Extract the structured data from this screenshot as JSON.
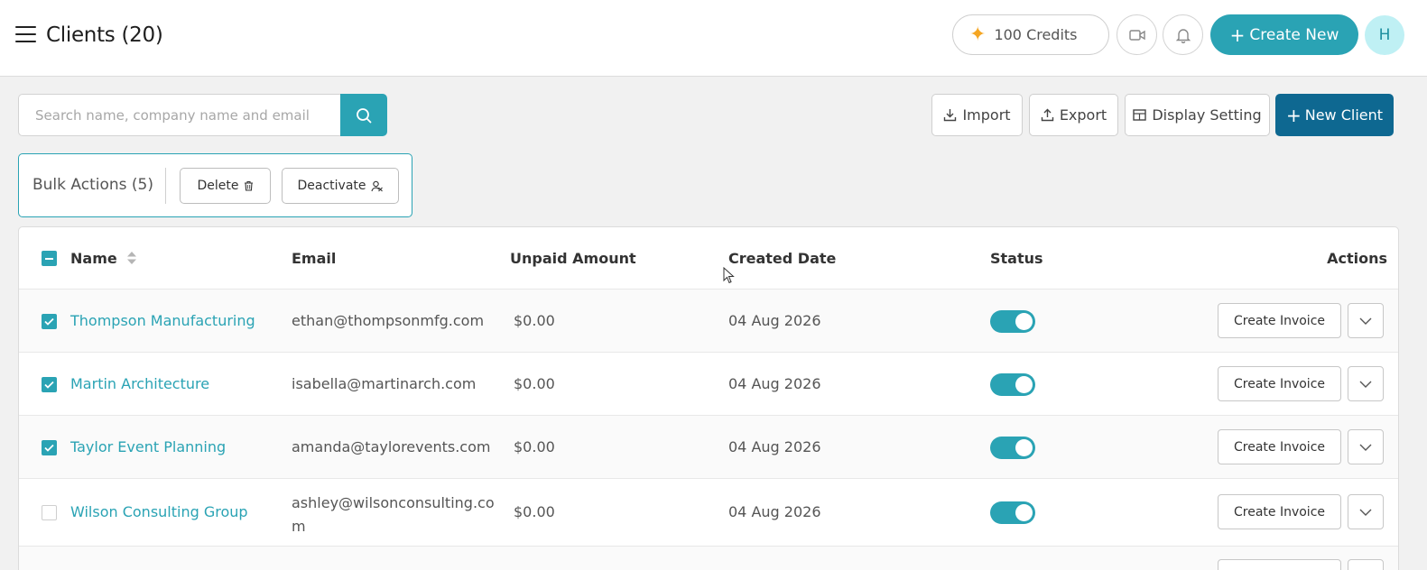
{
  "header": {
    "title": "Clients (20)",
    "credits_label": "100 Credits",
    "create_new_label": "Create New",
    "avatar_initial": "H"
  },
  "toolbar": {
    "search_placeholder": "Search name, company name and email",
    "import_label": "Import",
    "export_label": "Export",
    "display_setting_label": "Display Setting",
    "new_client_label": "New Client"
  },
  "bulk": {
    "label": "Bulk Actions (5)",
    "delete_label": "Delete",
    "deactivate_label": "Deactivate"
  },
  "table": {
    "columns": [
      "Name",
      "Email",
      "Unpaid Amount",
      "Created Date",
      "Status",
      "Actions"
    ],
    "rows": [
      {
        "checked": true,
        "name": "Thompson Manufacturing",
        "email": "ethan@thompsonmfg.com",
        "unpaid": "$0.00",
        "created": "04 Aug 2026",
        "active": true,
        "action_label": "Create Invoice"
      },
      {
        "checked": true,
        "name": "Martin Architecture",
        "email": "isabella@martinarch.com",
        "unpaid": "$0.00",
        "created": "04 Aug 2026",
        "active": true,
        "action_label": "Create Invoice"
      },
      {
        "checked": true,
        "name": "Taylor Event Planning",
        "email": "amanda@taylorevents.com",
        "unpaid": "$0.00",
        "created": "04 Aug 2026",
        "active": true,
        "action_label": "Create Invoice"
      },
      {
        "checked": false,
        "name": "Wilson Consulting Group",
        "email_line1": "ashley@wilsonconsulting.co",
        "email_line2": "m",
        "unpaid": "$0.00",
        "created": "04 Aug 2026",
        "active": true,
        "action_label": "Create Invoice"
      }
    ]
  },
  "colors": {
    "accent": "#2aa3b4",
    "primary_dark": "#0e6891",
    "credits_icon": "#f5a623"
  },
  "icons": [
    "menu-icon",
    "sparkle-icon",
    "video-icon",
    "bell-icon",
    "plus-icon",
    "search-icon",
    "download-icon",
    "upload-icon",
    "table-icon",
    "trash-icon",
    "user-off-icon",
    "sort-icon",
    "check-icon",
    "chevron-down-icon"
  ]
}
